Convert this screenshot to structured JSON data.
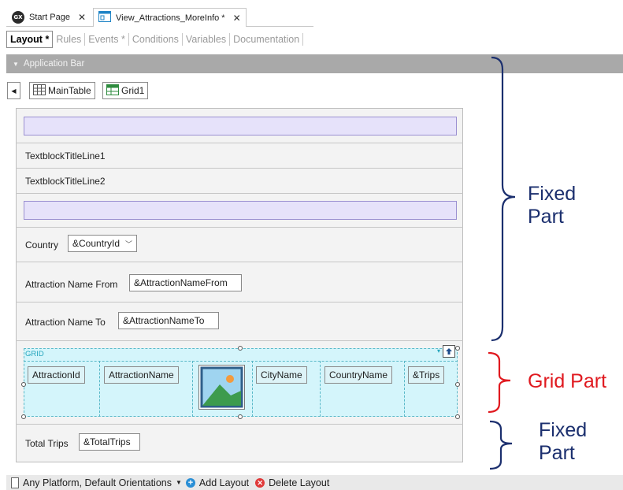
{
  "doc_tabs": [
    {
      "label": "Start Page",
      "icon": "gx-logo"
    },
    {
      "label": "View_Attractions_MoreInfo *",
      "icon": "webpanel-icon"
    }
  ],
  "subtabs": [
    "Layout *",
    "Rules",
    "Events *",
    "Conditions",
    "Variables",
    "Documentation"
  ],
  "app_bar": {
    "label": "Application Bar"
  },
  "breadcrumb": {
    "main_table": "MainTable",
    "grid": "Grid1"
  },
  "form": {
    "title_line1": "TextblockTitleLine1",
    "title_line2": "TextblockTitleLine2",
    "country_label": "Country",
    "country_value": "&CountryId",
    "from_label": "Attraction Name From",
    "from_value": "&AttractionNameFrom",
    "to_label": "Attraction Name To",
    "to_value": "&AttractionNameTo"
  },
  "grid": {
    "caption": "GRID",
    "columns": [
      "AttractionId",
      "AttractionName",
      "CityName",
      "CountryName",
      "&Trips"
    ]
  },
  "footer": {
    "total_label": "Total Trips",
    "total_value": "&TotalTrips"
  },
  "bottom_bar": {
    "platform_label": "Any Platform, Default Orientations",
    "add_layout": "Add Layout",
    "delete_layout": "Delete Layout"
  },
  "annotations": {
    "fixed_top_line1": "Fixed",
    "fixed_top_line2": "Part",
    "grid_part": "Grid Part",
    "fixed_bottom_line1": "Fixed",
    "fixed_bottom_line2": "Part"
  },
  "colors": {
    "annotation_blue": "#1b2f6e",
    "annotation_red": "#e0191f",
    "grid_fill": "#d4f5fb",
    "app_bar": "#a9a9a9"
  }
}
